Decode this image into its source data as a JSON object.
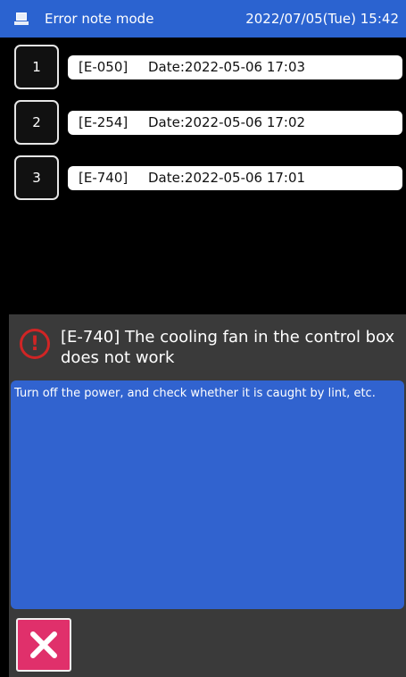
{
  "header": {
    "title": "Error note mode",
    "datetime": "2022/07/05(Tue) 15:42",
    "icon": "machine-icon"
  },
  "errors": [
    {
      "index": "1",
      "code": "[E-050]",
      "date": "Date:2022-05-06  17:03"
    },
    {
      "index": "2",
      "code": "[E-254]",
      "date": "Date:2022-05-06  17:02"
    },
    {
      "index": "3",
      "code": "[E-740]",
      "date": "Date:2022-05-06  17:01"
    }
  ],
  "detail": {
    "icon": "alert-icon",
    "message": "[E-740] The cooling fan in the control box does not work",
    "hint": "Turn off the power, and check whether it is caught by lint, etc.",
    "close_icon": "close-icon"
  },
  "colors": {
    "header_bg": "#2b63d0",
    "hint_bg": "#3163cf",
    "panel_bg": "#3a3a3a",
    "alert": "#d02525",
    "close_bg": "#e0306b"
  }
}
